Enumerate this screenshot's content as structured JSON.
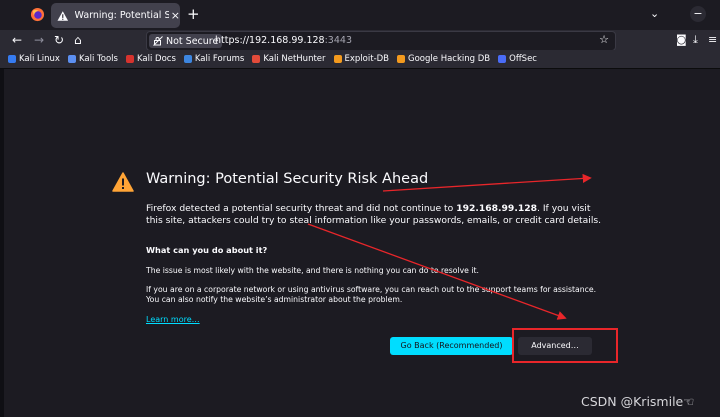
{
  "browser": {
    "tab_title": "Warning: Potential Security Risk Ahead",
    "tab_close": "×",
    "new_tab": "+",
    "tab_list": "⌄",
    "url_prefix": "https://192.168.99.128",
    "url_port": ":3443",
    "not_secure_label": "Not Secure",
    "bookmarks": [
      {
        "label": "Kali Linux",
        "color": "#367bf0"
      },
      {
        "label": "Kali Tools",
        "color": "#5c8ff0"
      },
      {
        "label": "Kali Docs",
        "color": "#d6332e"
      },
      {
        "label": "Kali Forums",
        "color": "#3d86e0"
      },
      {
        "label": "Kali NetHunter",
        "color": "#e24b3a"
      },
      {
        "label": "Exploit-DB",
        "color": "#f39a1e"
      },
      {
        "label": "Google Hacking DB",
        "color": "#f39a1e"
      },
      {
        "label": "OffSec",
        "color": "#4a6cf7"
      }
    ]
  },
  "page": {
    "heading": "Warning: Potential Security Risk Ahead",
    "intro_before": "Firefox detected a potential security threat and did not continue to ",
    "intro_host": "192.168.99.128",
    "intro_after": ". If you visit this site, attackers could try to steal information like your passwords, emails, or credit card details.",
    "what_heading": "What can you do about it?",
    "para2": "The issue is most likely with the website, and there is nothing you can do to resolve it.",
    "para3": "If you are on a corporate network or using antivirus software, you can reach out to the support teams for assistance. You can also notify the website’s administrator about the problem.",
    "learn_more": "Learn more…",
    "go_back_label": "Go Back (Recommended)",
    "advanced_label": "Advanced…"
  },
  "watermark": "CSDN @Krismile☜",
  "colors": {
    "accent": "#00ddff",
    "annotation": "#e8262a",
    "warning": "#ffa436"
  }
}
